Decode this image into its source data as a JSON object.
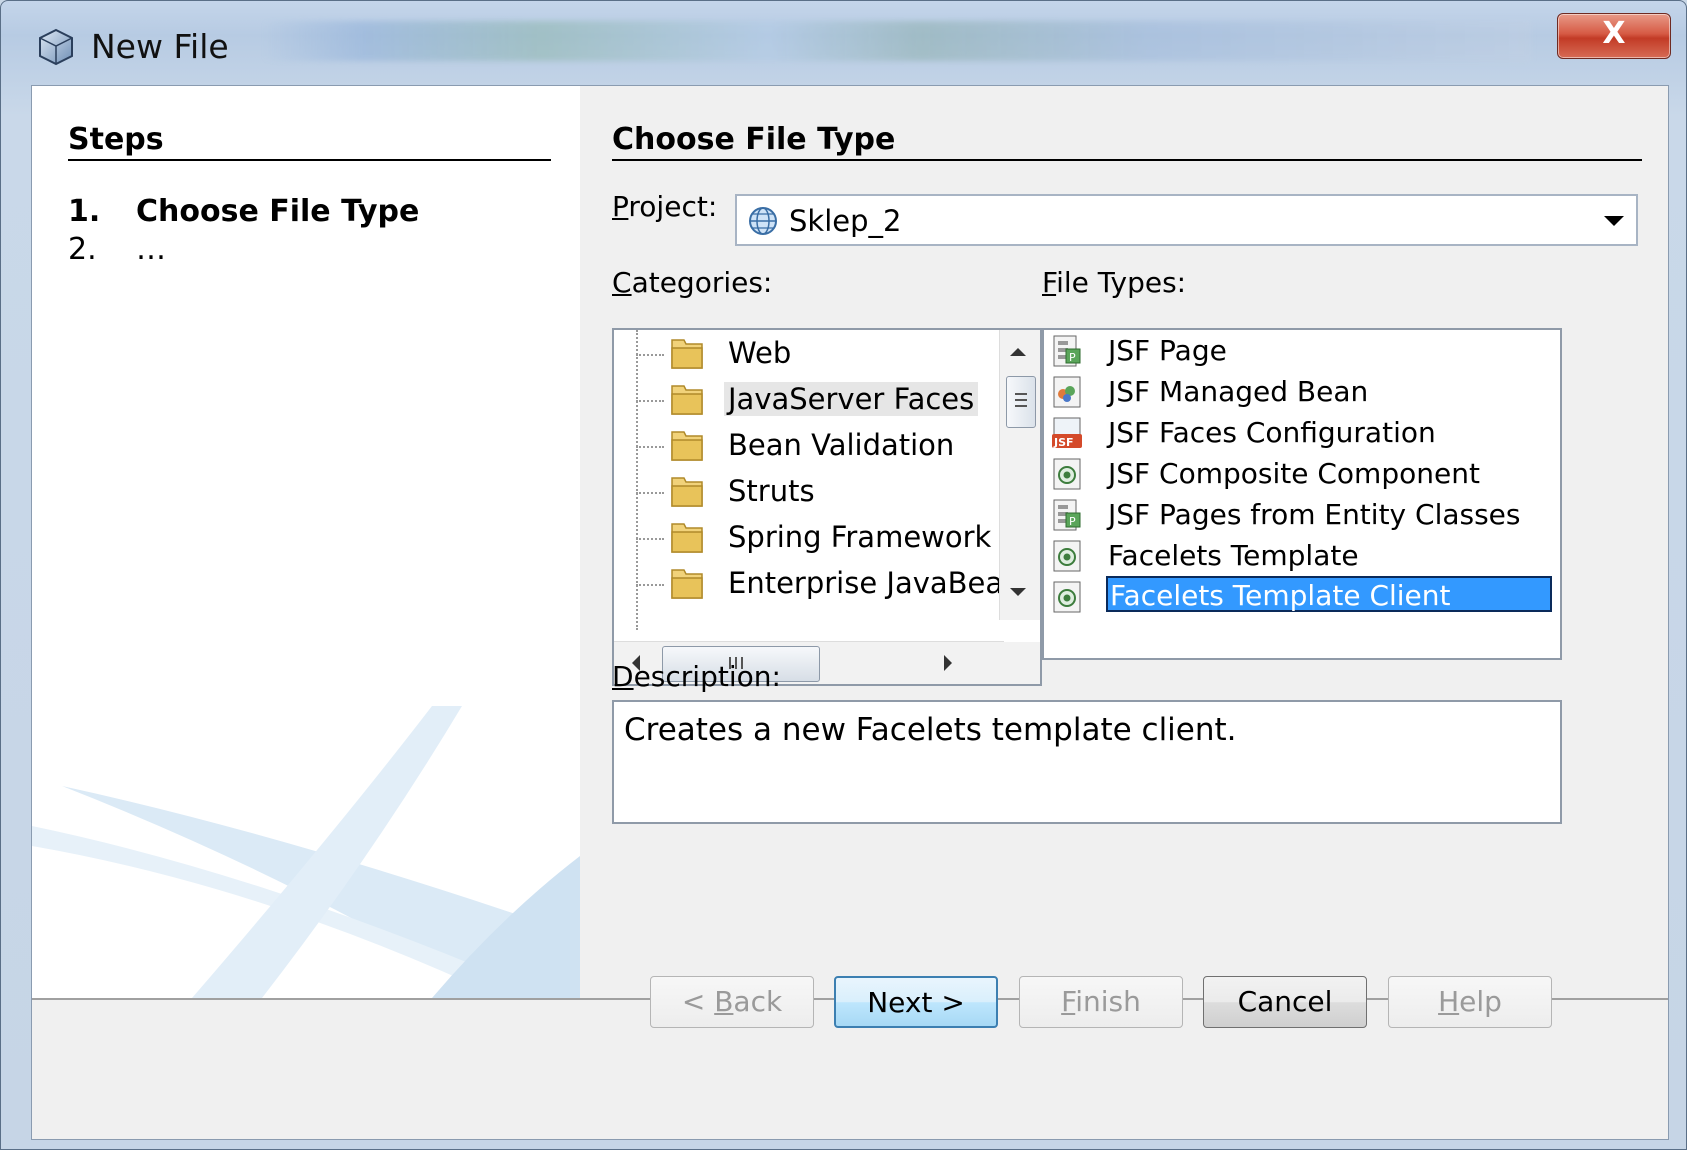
{
  "window": {
    "title": "New File",
    "close_label": "X"
  },
  "steps": {
    "heading": "Steps",
    "items": [
      {
        "num": "1.",
        "label": "Choose File Type"
      },
      {
        "num": "2.",
        "label": "…"
      }
    ]
  },
  "main": {
    "heading": "Choose File Type",
    "project": {
      "label_first": "P",
      "label_rest": "roject:",
      "value": "Sklep_2",
      "icon": "globe-icon"
    },
    "categories": {
      "label_first": "C",
      "label_rest": "ategories:",
      "items": [
        "Web",
        "JavaServer Faces",
        "Bean Validation",
        "Struts",
        "Spring Framework",
        "Enterprise JavaBea"
      ],
      "selected": "JavaServer Faces"
    },
    "file_types": {
      "label_first": "F",
      "label_rest": "ile Types:",
      "items": [
        {
          "label": "JSF Page",
          "icon": "jsf-page-icon"
        },
        {
          "label": "JSF Managed Bean",
          "icon": "managed-bean-icon"
        },
        {
          "label": "JSF Faces Configuration",
          "icon": "jsf-config-icon"
        },
        {
          "label": "JSF Composite Component",
          "icon": "facelets-icon"
        },
        {
          "label": "JSF Pages from Entity Classes",
          "icon": "jsf-page-icon"
        },
        {
          "label": "Facelets Template",
          "icon": "facelets-icon"
        },
        {
          "label": "Facelets Template Client",
          "icon": "facelets-icon"
        }
      ],
      "selected": "Facelets Template Client"
    },
    "description": {
      "label_first": "D",
      "label_rest": "escription:",
      "text": "Creates a new Facelets template client."
    }
  },
  "buttons": {
    "back": {
      "pre": "< ",
      "mn": "B",
      "post": "ack",
      "enabled": false
    },
    "next": {
      "label": "Next >",
      "enabled": true
    },
    "finish": {
      "mn": "F",
      "post": "inish",
      "enabled": false
    },
    "cancel": {
      "label": "Cancel",
      "enabled": true
    },
    "help": {
      "mn": "H",
      "post": "elp",
      "enabled": false
    }
  },
  "colors": {
    "selection": "#3399ff",
    "folder": "#e8c35a",
    "default_button_border": "#3c7fb1"
  }
}
